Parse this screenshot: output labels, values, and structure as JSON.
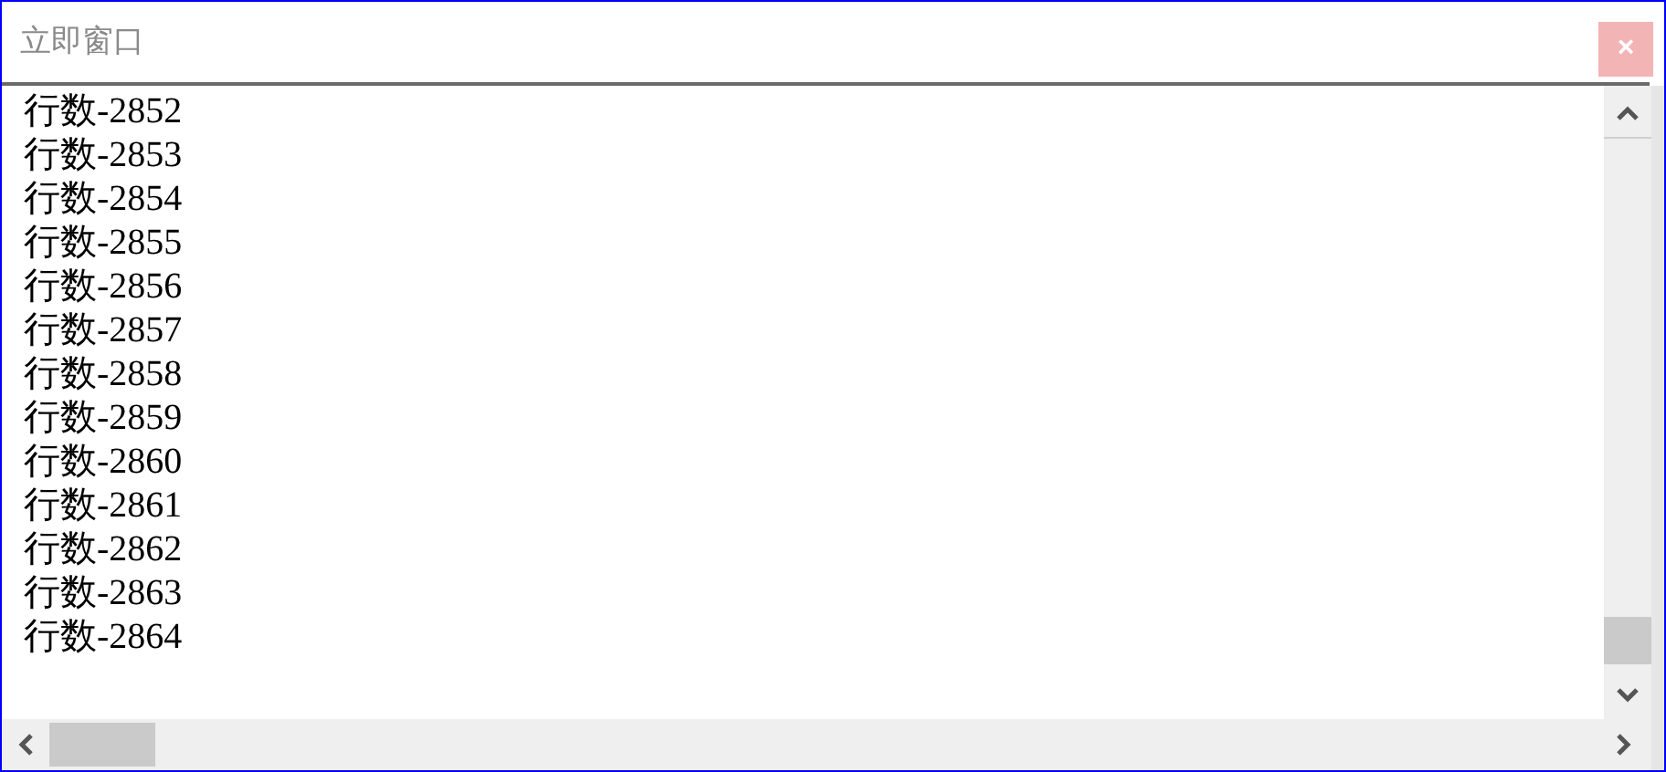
{
  "window": {
    "title": "立即窗口",
    "close": "×"
  },
  "lines": [
    "行数-2852",
    "行数-2853",
    "行数-2854",
    "行数-2855",
    "行数-2856",
    "行数-2857",
    "行数-2858",
    "行数-2859",
    "行数-2860",
    "行数-2861",
    "行数-2862",
    "行数-2863",
    "行数-2864"
  ]
}
